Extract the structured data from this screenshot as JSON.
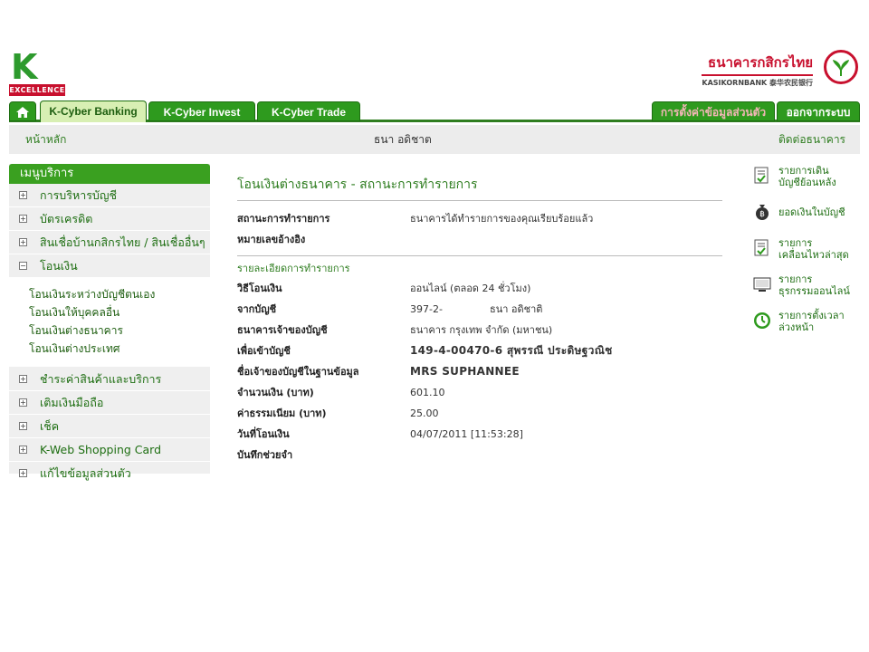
{
  "header": {
    "logo_mark": "K",
    "logo_label": "EXCELLENCE",
    "bank_name_th": "ธนาคารกสิกรไทย",
    "bank_name_en": "KASIKORNBANK 泰华农民银行"
  },
  "tabs": {
    "kcyber_banking": "K-Cyber Banking",
    "kcyber_invest": "K-Cyber Invest",
    "kcyber_trade": "K-Cyber Trade",
    "settings": "การตั้งค่าข้อมูลส่วนตัว",
    "logout": "ออกจากระบบ"
  },
  "subbar": {
    "home": "หน้าหลัก",
    "user": "ธนา อดิชาต",
    "contact": "ติดต่อธนาคาร"
  },
  "sidebar": {
    "title": "เมนูบริการ",
    "items_top": [
      {
        "label": "การบริหารบัญชี",
        "toggle": "+"
      },
      {
        "label": "บัตรเครดิต",
        "toggle": "+"
      },
      {
        "label": "สินเชื่อบ้านกสิกรไทย / สินเชื่ออื่นๆ",
        "toggle": "+"
      },
      {
        "label": "โอนเงิน",
        "toggle": "−"
      }
    ],
    "transfer_sub": [
      "โอนเงินระหว่างบัญชีตนเอง",
      "โอนเงินให้บุคคลอื่น",
      "โอนเงินต่างธนาคาร",
      "โอนเงินต่างประเทศ"
    ],
    "items_bottom": [
      {
        "label": "ชำระค่าสินค้าและบริการ",
        "toggle": "+"
      },
      {
        "label": "เติมเงินมือถือ",
        "toggle": "+"
      },
      {
        "label": "เช็ค",
        "toggle": "+"
      },
      {
        "label": "K-Web Shopping Card",
        "toggle": "+"
      },
      {
        "label": "แก้ไขข้อมูลส่วนตัว",
        "toggle": "+"
      }
    ]
  },
  "main": {
    "title": "โอนเงินต่างธนาคาร - สถานะการทำรายการ",
    "status_label": "สถานะการทำรายการ",
    "status_value": "ธนาคารได้ทำรายการของคุณเรียบร้อยแล้ว",
    "ref_label": "หมายเลขอ้างอิง",
    "ref_value": "",
    "details_title": "รายละเอียดการทำรายการ",
    "method_label": "วิธีโอนเงิน",
    "method_value": "ออนไลน์ (ตลอด 24 ชั่วโมง)",
    "from_label": "จากบัญชี",
    "from_account": "397-2-",
    "from_name": "ธนา อดิชาติ",
    "bank_label": "ธนาคารเจ้าของบัญชี",
    "bank_value": "ธนาคาร กรุงเทพ จำกัด (มหาชน)",
    "to_label": "เพื่อเข้าบัญชี",
    "to_value": "149-4-00470-6 สุพรรณี ประดิษฐวณิช",
    "owner_label": "ชื่อเจ้าของบัญชีในฐานข้อมูล",
    "owner_value": "MRS SUPHANNEE",
    "amount_label": "จำนวนเงิน (บาท)",
    "amount_value": "601.10",
    "fee_label": "ค่าธรรมเนียม (บาท)",
    "fee_value": "25.00",
    "date_label": "วันที่โอนเงิน",
    "date_value": "04/07/2011 [11:53:28]",
    "memo_label": "บันทึกช่วยจำ",
    "memo_value": ""
  },
  "rightpanel": {
    "items": [
      {
        "line1": "รายการเดิน",
        "line2": "บัญชีย้อนหลัง",
        "icon": "statement-icon"
      },
      {
        "line1": "ยอดเงินในบัญชี",
        "line2": "",
        "icon": "money-bag-icon"
      },
      {
        "line1": "รายการ",
        "line2": "เคลื่อนไหวล่าสุด",
        "icon": "recent-transactions-icon"
      },
      {
        "line1": "รายการ",
        "line2": "ธุรกรรมออนไลน์",
        "icon": "online-transactions-icon"
      },
      {
        "line1": "รายการตั้งเวลา",
        "line2": "ล่วงหน้า",
        "icon": "clock-icon"
      }
    ]
  },
  "colors": {
    "brand_green": "#2e9a1e",
    "brand_red": "#c8102e",
    "link_green": "#2e7d1f"
  }
}
